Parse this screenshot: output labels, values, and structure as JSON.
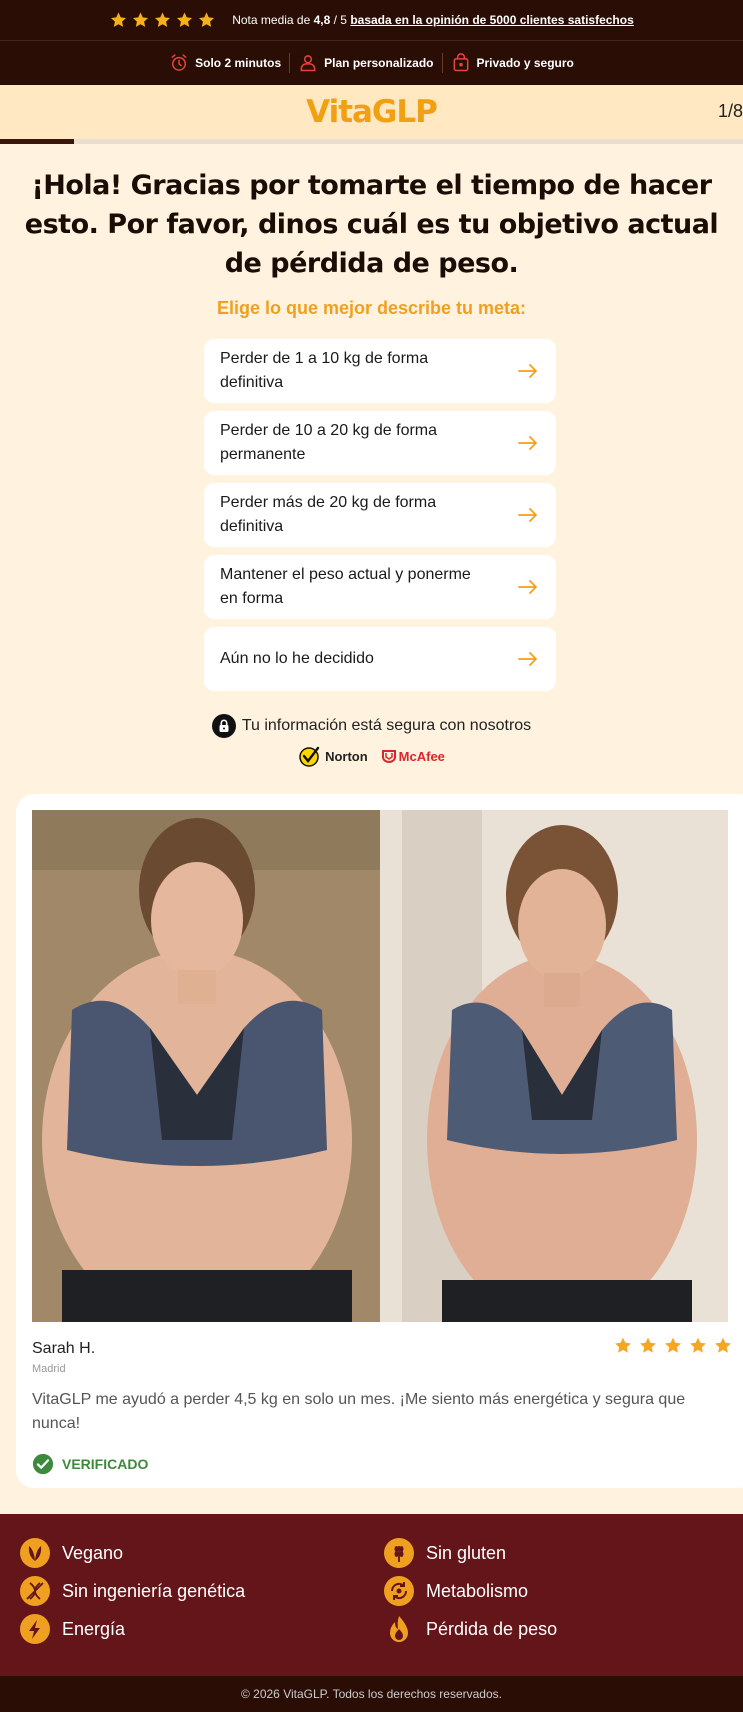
{
  "topbar": {
    "rating_prefix": "Nota media de ",
    "rating_value": "4,8",
    "rating_scale": " / 5 ",
    "rating_link": "basada en la opinión de 5000 clientes satisfechos",
    "stars": 5,
    "star_color": "#f5b01c"
  },
  "trust": {
    "items": [
      "Solo 2 minutos",
      "Plan personalizado",
      "Privado y seguro"
    ],
    "icon_color": "#e8433a"
  },
  "header": {
    "logo": "VitaGLP",
    "step": "1/8",
    "progress": 0.1,
    "brand_color": "#f0a010"
  },
  "quiz": {
    "headline": "¡Hola! Gracias por tomarte el tiempo de hacer esto. Por favor, dinos cuál es tu objetivo actual de pérdida de peso.",
    "subhead": "Elige lo que mejor describe tu meta:",
    "options": [
      "Perder de 1 a 10 kg de forma definitiva",
      "Perder de 10 a 20 kg de forma permanente",
      "Perder más de 20 kg de forma definitiva",
      "Mantener el peso actual y ponerme en forma",
      "Aún no lo he decidido"
    ],
    "arrow_color": "#f0a020"
  },
  "security": {
    "text": "Tu información está segura con nosotros",
    "badges": [
      "Norton",
      "McAfee"
    ]
  },
  "review": {
    "name": "Sarah H.",
    "city": "Madrid",
    "stars": 5,
    "text": "VitaGLP me ayudó a perder 4,5 kg en solo un mes. ¡Me siento más energética y segura que nunca!",
    "verified": "VERIFICADO",
    "verified_color": "#3d8a3d"
  },
  "features": {
    "items": [
      {
        "label": "Vegano",
        "icon": "leaf-icon"
      },
      {
        "label": "Sin gluten",
        "icon": "wheat-icon"
      },
      {
        "label": "Sin ingeniería genética",
        "icon": "dna-icon"
      },
      {
        "label": "Metabolismo",
        "icon": "cycle-icon"
      },
      {
        "label": "Energía",
        "icon": "lightning-icon"
      },
      {
        "label": "Pérdida de peso",
        "icon": "flame-icon"
      }
    ],
    "icon_color": "#f0a020"
  },
  "footer": {
    "text": "© 2026 VitaGLP. Todos los derechos reservados."
  }
}
